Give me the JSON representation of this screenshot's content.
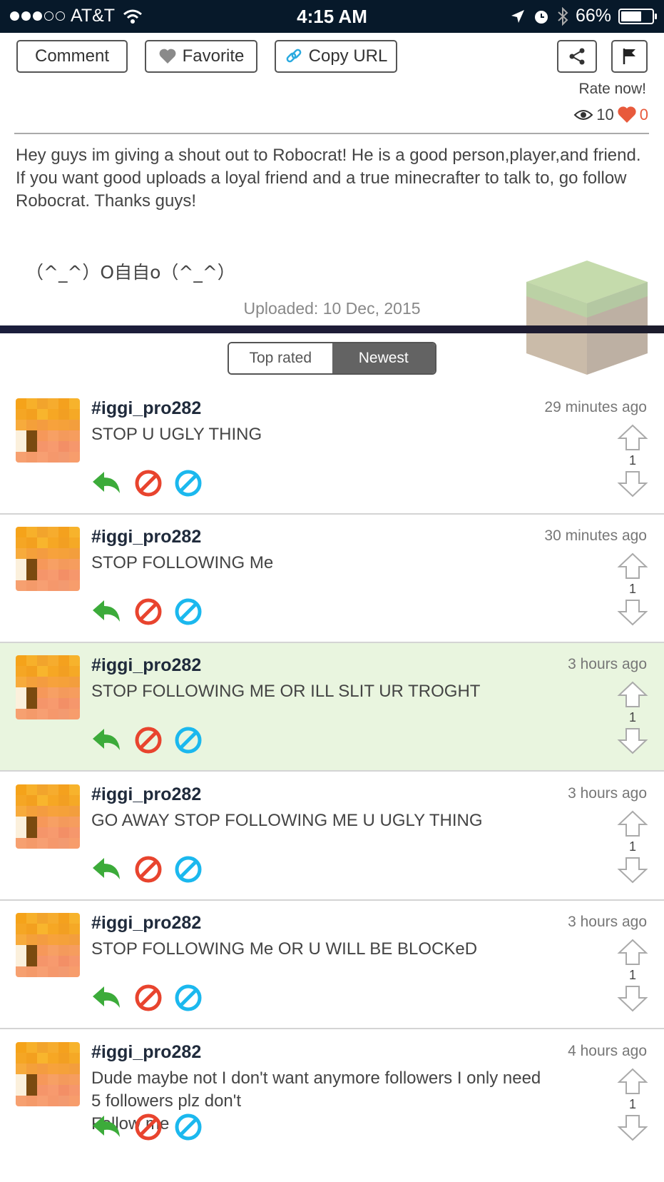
{
  "status_bar": {
    "carrier": "AT&T",
    "time": "4:15 AM",
    "battery": "66%",
    "battery_level": 0.66
  },
  "toolbar": {
    "comment_label": "Comment",
    "favorite_label": "Favorite",
    "copy_url_label": "Copy URL"
  },
  "rating": {
    "rate_now": "Rate now!",
    "views": "10",
    "likes": "0"
  },
  "post": {
    "description": "Hey guys im giving a shout out to Robocrat! He is a good person,player,and friend. If you want good uploads a loyal friend and a true minecrafter to talk to, go follow\nRobocrat. Thanks guys!",
    "kaomoji": "（^_^）O自自o（^_^）",
    "uploaded": "Uploaded: 10 Dec, 2015"
  },
  "sort_tabs": {
    "top_rated": "Top rated",
    "newest": "Newest",
    "selected": "Newest"
  },
  "comments": [
    {
      "user": "#iggi_pro282",
      "text": "STOP U UGLY THING",
      "time": "29 minutes ago",
      "votes": "1"
    },
    {
      "user": "#iggi_pro282",
      "text": "STOP FOLLOWING Me",
      "time": "30 minutes ago",
      "votes": "1"
    },
    {
      "user": "#iggi_pro282",
      "text": "STOP FOLLOWING ME OR ILL SLIT UR TROGHT",
      "time": "3 hours ago",
      "votes": "1",
      "highlighted": true
    },
    {
      "user": "#iggi_pro282",
      "text": "GO AWAY STOP FOLLOWING ME U UGLY THING",
      "time": "3 hours ago",
      "votes": "1"
    },
    {
      "user": "#iggi_pro282",
      "text": "STOP FOLLOWING Me OR U WILL BE BLOCKeD",
      "time": "3 hours ago",
      "votes": "1"
    },
    {
      "user": "#iggi_pro282",
      "text": "Dude maybe not I don't want anymore followers I only need 5 followers plz don't\nFollow me",
      "time": "4 hours ago",
      "votes": "1"
    }
  ],
  "colors": {
    "status_bar_bg": "#07192a",
    "highlight_bg": "#e9f5df",
    "reply_green": "#3cab3a",
    "block_red": "#e8442e",
    "ignore_blue": "#1bb8ee",
    "heart_red": "#e85a3c"
  }
}
